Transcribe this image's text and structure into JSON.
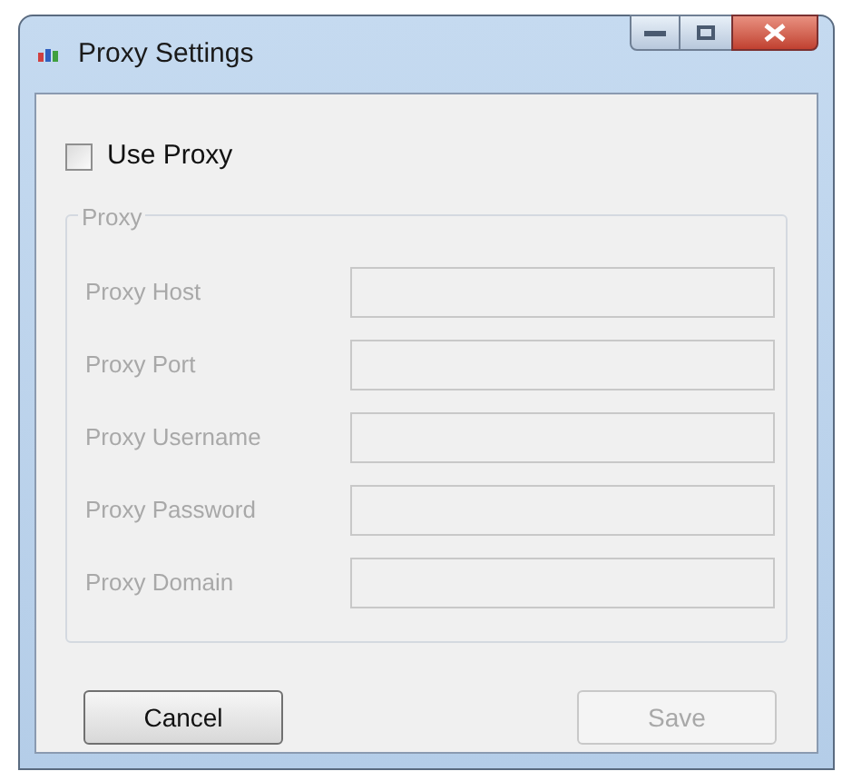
{
  "window": {
    "title": "Proxy Settings"
  },
  "use_proxy": {
    "label": "Use Proxy",
    "checked": false
  },
  "group": {
    "title": "Proxy",
    "disabled": true,
    "fields": [
      {
        "label": "Proxy Host"
      },
      {
        "label": "Proxy Port"
      },
      {
        "label": "Proxy Username"
      },
      {
        "label": "Proxy Password"
      },
      {
        "label": "Proxy Domain"
      }
    ]
  },
  "buttons": [
    {
      "label": "Cancel",
      "disabled": false
    },
    {
      "label": "Save",
      "disabled": true
    }
  ]
}
